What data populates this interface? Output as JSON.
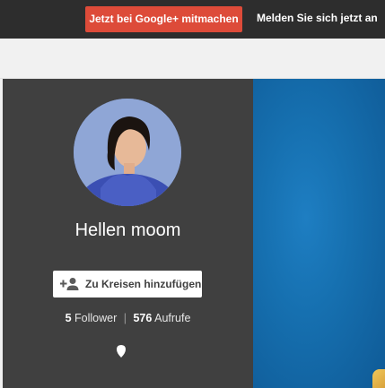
{
  "topbar": {
    "join_label": "Jetzt bei Google+ mitmachen",
    "signin_text": "Melden Sie sich jetzt an"
  },
  "profile": {
    "name": "Hellen moom",
    "add_circles_label": "Zu Kreisen hinzufügen",
    "followers_count": "5",
    "followers_label": "Follower",
    "separator": "|",
    "views_count": "576",
    "views_label": "Aufrufe"
  },
  "colors": {
    "topbar": "#2d2d2d",
    "join_button": "#dd4b39",
    "panel": "#404040",
    "cover": "#1670b0"
  },
  "icons": {
    "add_person": "person-add-icon",
    "location": "location-pin-icon"
  }
}
